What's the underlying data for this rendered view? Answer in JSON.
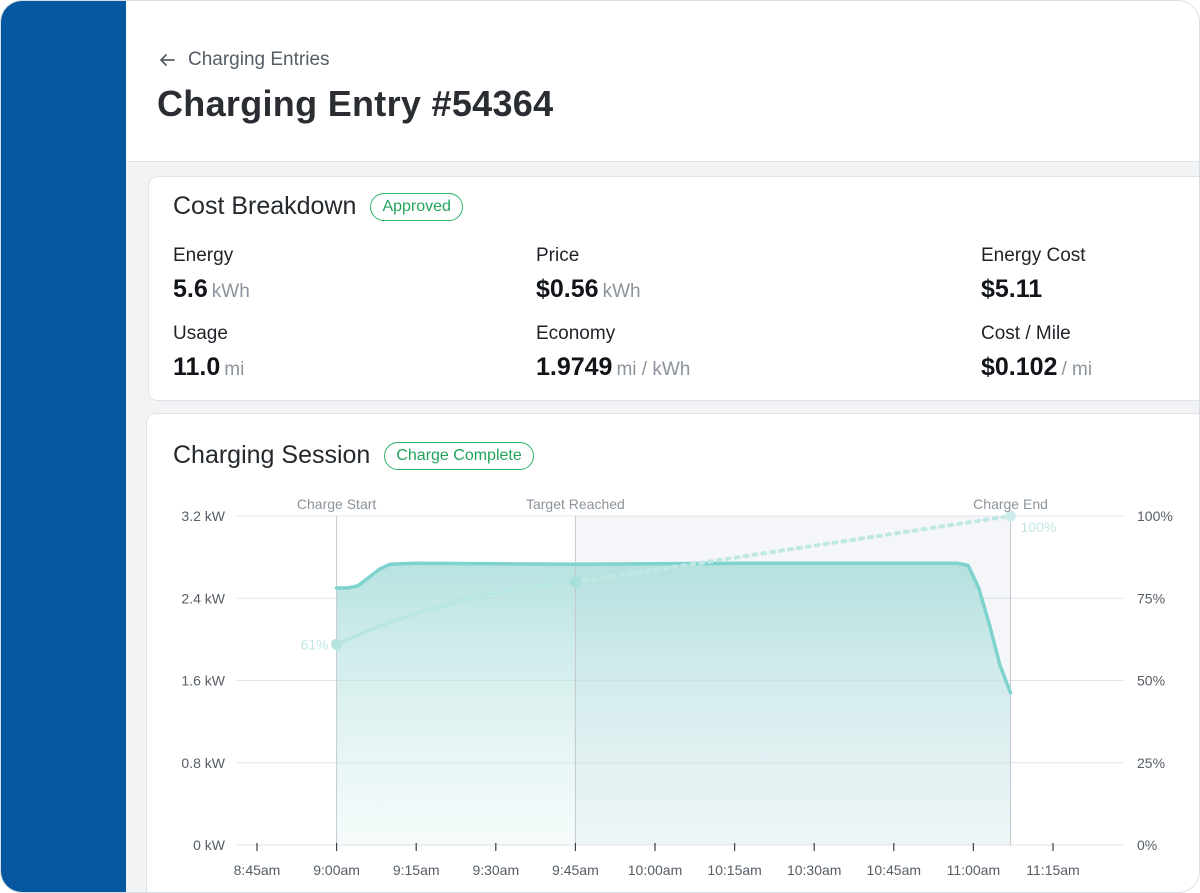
{
  "header": {
    "back_label": "Charging Entries",
    "title": "Charging Entry #54364"
  },
  "cost_breakdown": {
    "title": "Cost Breakdown",
    "badge": "Approved",
    "metrics": [
      {
        "label": "Energy",
        "value": "5.6",
        "unit": "kWh"
      },
      {
        "label": "Price",
        "value": "$0.56",
        "unit": "kWh"
      },
      {
        "label": "Energy Cost",
        "value": "$5.11",
        "unit": ""
      },
      {
        "label": "Usage",
        "value": "11.0",
        "unit": "mi"
      },
      {
        "label": "Economy",
        "value": "1.9749",
        "unit": "mi / kWh"
      },
      {
        "label": "Cost / Mile",
        "value": "$0.102",
        "unit": "/ mi"
      }
    ]
  },
  "session": {
    "title": "Charging Session",
    "badge": "Charge Complete"
  },
  "colors": {
    "sidebar": "#05579f",
    "badge_green": "#22a35c",
    "series_teal": "#7fd3cf"
  },
  "chart_data": {
    "type": "area",
    "x_ticks": [
      "8:45am",
      "9:00am",
      "9:15am",
      "9:30am",
      "9:45am",
      "10:00am",
      "10:15am",
      "10:30am",
      "10:45am",
      "11:00am",
      "11:15am"
    ],
    "y_left": {
      "ticks": [
        "0 kW",
        "0.8 kW",
        "1.6 kW",
        "2.4 kW",
        "3.2 kW"
      ],
      "range": [
        0,
        3.2
      ]
    },
    "y_right": {
      "ticks": [
        "0%",
        "25%",
        "50%",
        "75%",
        "100%"
      ],
      "range": [
        0,
        100
      ]
    },
    "markers": [
      {
        "label": "Charge Start",
        "time_min": 15
      },
      {
        "label": "Target Reached",
        "time_min": 60
      },
      {
        "label": "Charge End",
        "time_min": 142
      }
    ],
    "power_kw": [
      [
        15,
        2.5
      ],
      [
        17,
        2.5
      ],
      [
        19,
        2.52
      ],
      [
        21,
        2.6
      ],
      [
        23,
        2.68
      ],
      [
        25,
        2.73
      ],
      [
        30,
        2.74
      ],
      [
        60,
        2.73
      ],
      [
        90,
        2.74
      ],
      [
        120,
        2.74
      ],
      [
        132,
        2.74
      ],
      [
        134,
        2.72
      ],
      [
        136,
        2.5
      ],
      [
        138,
        2.15
      ],
      [
        140,
        1.75
      ],
      [
        142,
        1.48
      ]
    ],
    "soc_pct_actual": [
      [
        15,
        61
      ],
      [
        20,
        64.5
      ],
      [
        25,
        67.7
      ],
      [
        30,
        70.4
      ],
      [
        35,
        72.8
      ],
      [
        40,
        74.9
      ],
      [
        45,
        76.7
      ],
      [
        50,
        78.1
      ],
      [
        55,
        79.2
      ],
      [
        60,
        80
      ]
    ],
    "soc_pct_projected": [
      [
        60,
        80
      ],
      [
        142,
        100
      ]
    ],
    "soc_labels": [
      {
        "time_min": 15,
        "text": "61%"
      },
      {
        "time_min": 142,
        "text": "100%"
      }
    ]
  }
}
